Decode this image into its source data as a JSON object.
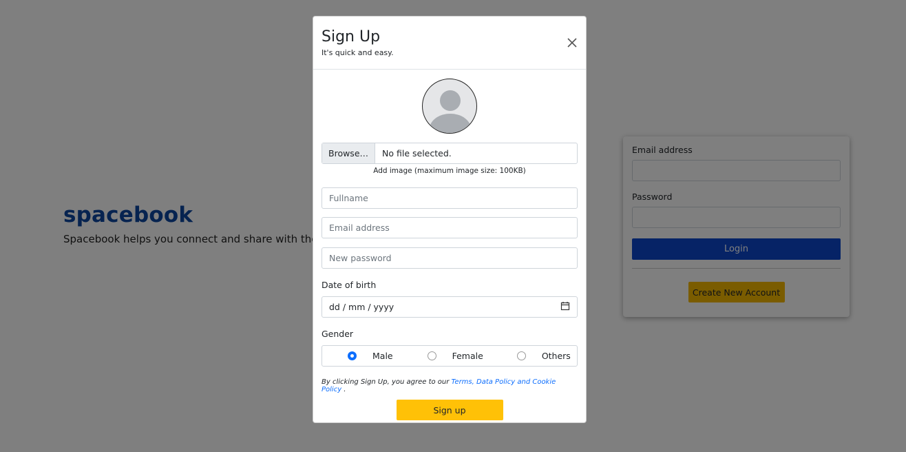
{
  "background": {
    "brand": "spacebook",
    "tagline": "Spacebook helps you connect and share with the people in your life.",
    "login": {
      "email_label": "Email address",
      "password_label": "Password",
      "login_button": "Login",
      "create_button": "Create New Account"
    }
  },
  "modal": {
    "title": "Sign Up",
    "subtitle": "It's quick and easy.",
    "close_icon": "close-icon",
    "file": {
      "browse_label": "Browse…",
      "status": "No file selected.",
      "hint": "Add image (maximum image size: 100KB)"
    },
    "fields": {
      "fullname_placeholder": "Fullname",
      "email_placeholder": "Email address",
      "password_placeholder": "New password"
    },
    "dob": {
      "label": "Date of birth",
      "placeholder": "dd / mm / yyyy",
      "icon": "calendar-icon"
    },
    "gender": {
      "label": "Gender",
      "options": [
        "Male",
        "Female",
        "Others"
      ],
      "selected": "Male"
    },
    "terms": {
      "prefix": "By clicking Sign Up, you agree to our ",
      "link": "Terms, Data Policy and Cookie Policy",
      "suffix": " ."
    },
    "signup_button": "Sign up"
  },
  "colors": {
    "brand": "#0d47a1",
    "login_button": "#0d47cc",
    "create_button": "#f5b800",
    "signup_button": "#ffc107",
    "link": "#0d6efd"
  }
}
